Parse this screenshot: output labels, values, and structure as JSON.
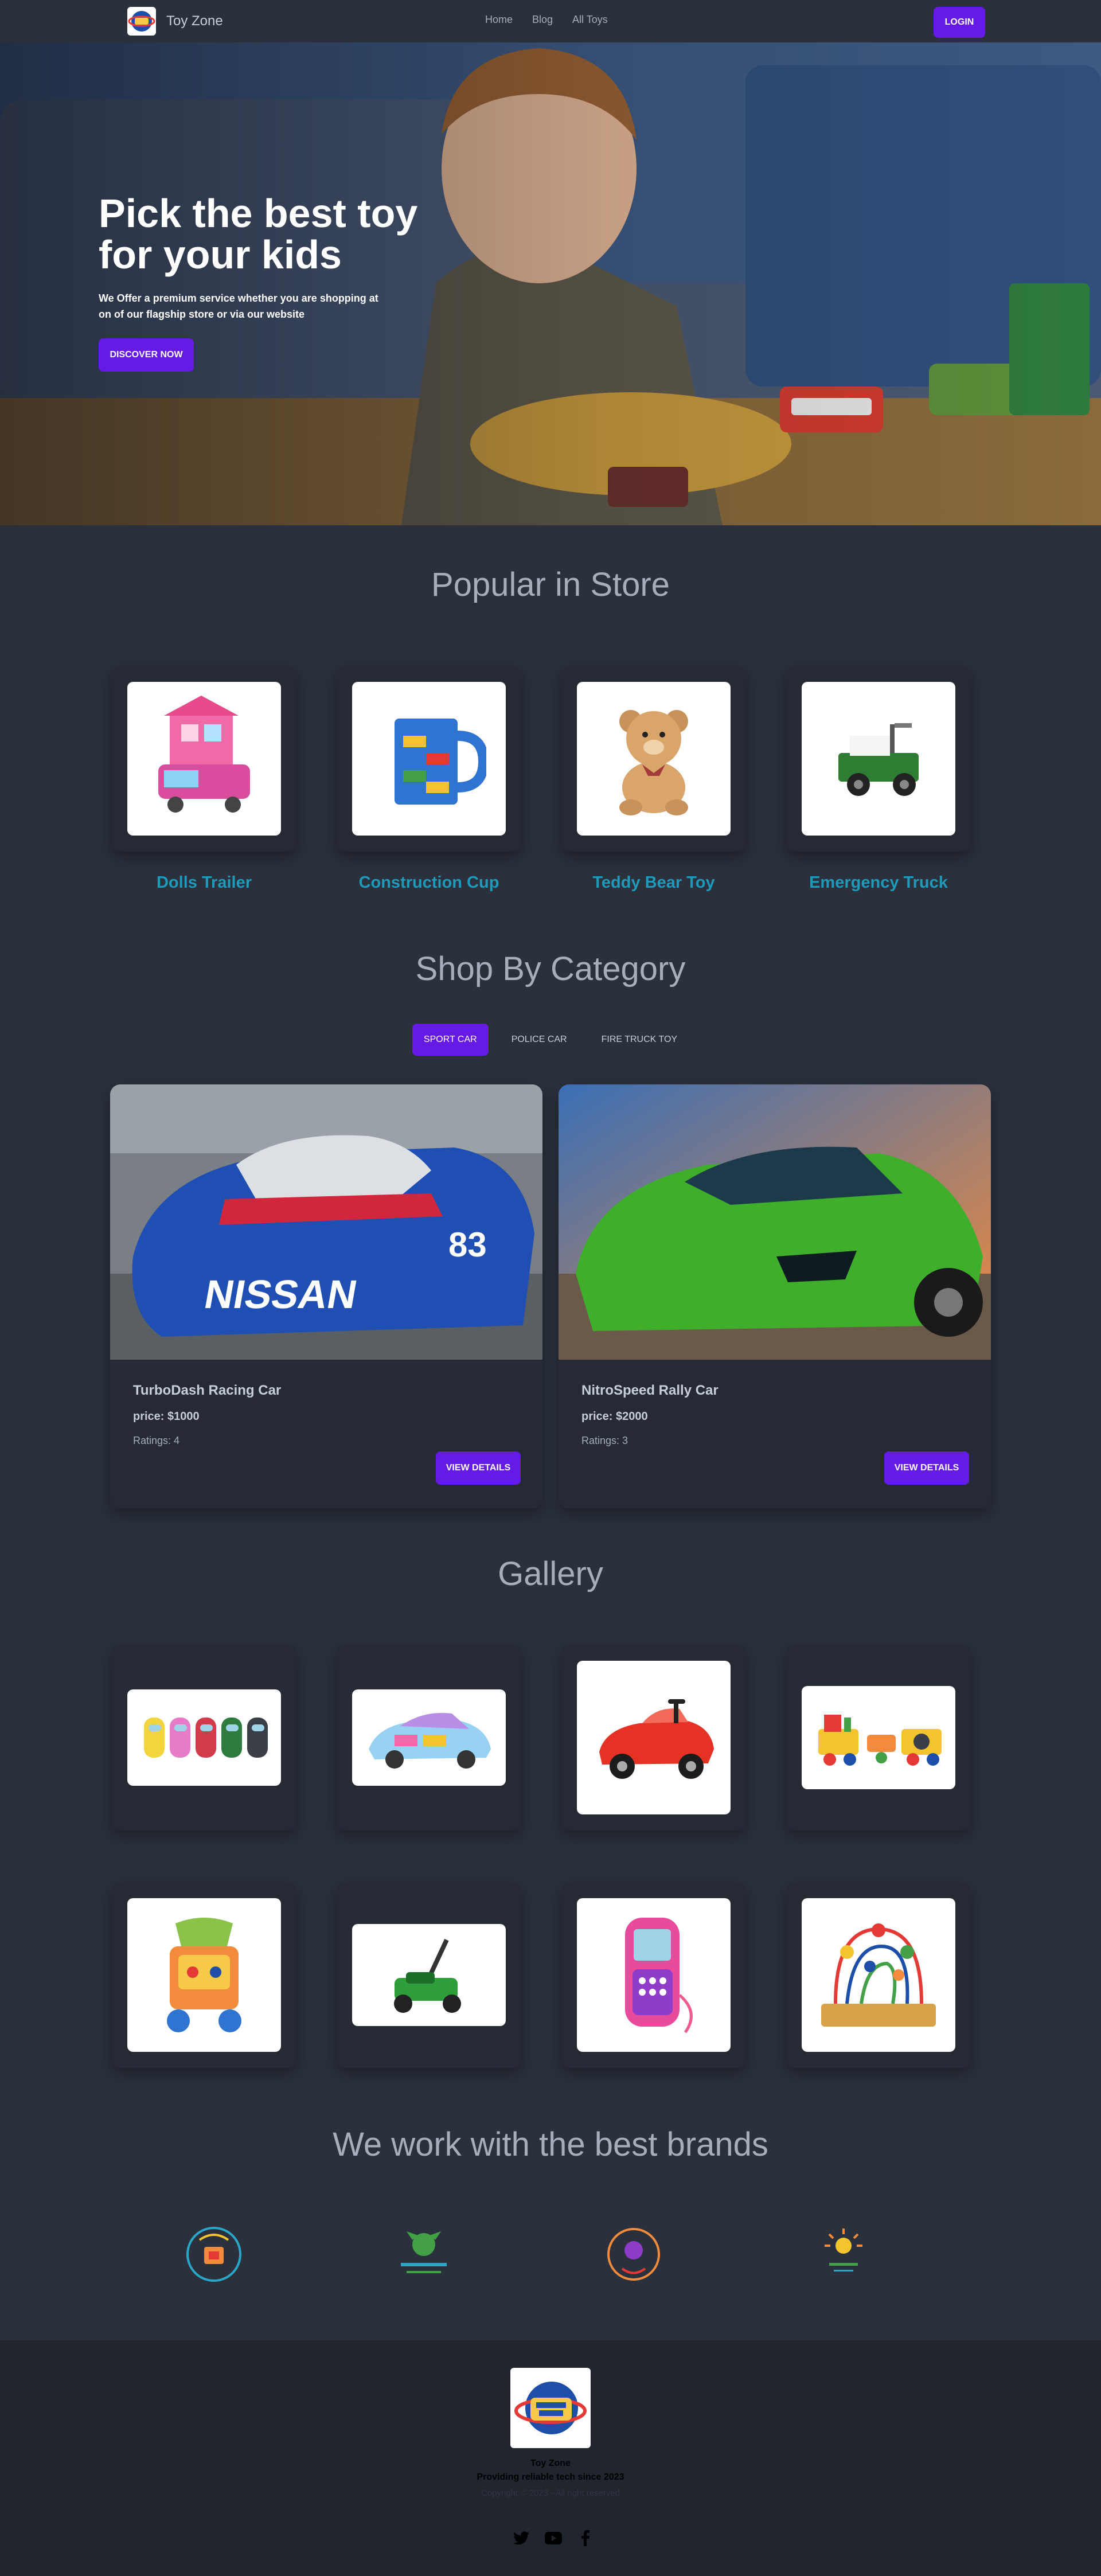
{
  "navbar": {
    "brand_name": "Toy Zone",
    "links": [
      "Home",
      "Blog",
      "All Toys"
    ],
    "login_label": "LOGIN"
  },
  "hero": {
    "title_line1": "Pick the best toy",
    "title_line2": "for your kids",
    "subtitle": "We Offer a premium service whether you are shopping at on of our flagship store or via our website",
    "button_label": "DISCOVER NOW"
  },
  "popular": {
    "title": "Popular in Store",
    "items": [
      "Dolls Trailer",
      "Construction Cup",
      "Teddy Bear Toy",
      "Emergency Truck"
    ]
  },
  "category": {
    "title": "Shop By Category",
    "tabs": [
      "SPORT CAR",
      "POLICE CAR",
      "FIRE TRUCK TOY"
    ],
    "active_tab": "SPORT CAR",
    "cards": [
      {
        "name": "TurboDash Racing Car",
        "price": "price: $1000",
        "rating": "Ratings: 4",
        "button": "VIEW DETAILS"
      },
      {
        "name": "NitroSpeed Rally Car",
        "price": "price: $2000",
        "rating": "Ratings: 3",
        "button": "VIEW DETAILS"
      }
    ]
  },
  "gallery": {
    "title": "Gallery"
  },
  "brands": {
    "title": "We work with the best brands"
  },
  "footer": {
    "name": "Toy Zone",
    "tagline": "Providing reliable tech since 2023",
    "copyright": "Copyright © 2023 - All right reserved"
  },
  "colors": {
    "accent": "#661ae6",
    "background": "#2a303c",
    "product_name": "#1f9aba"
  }
}
